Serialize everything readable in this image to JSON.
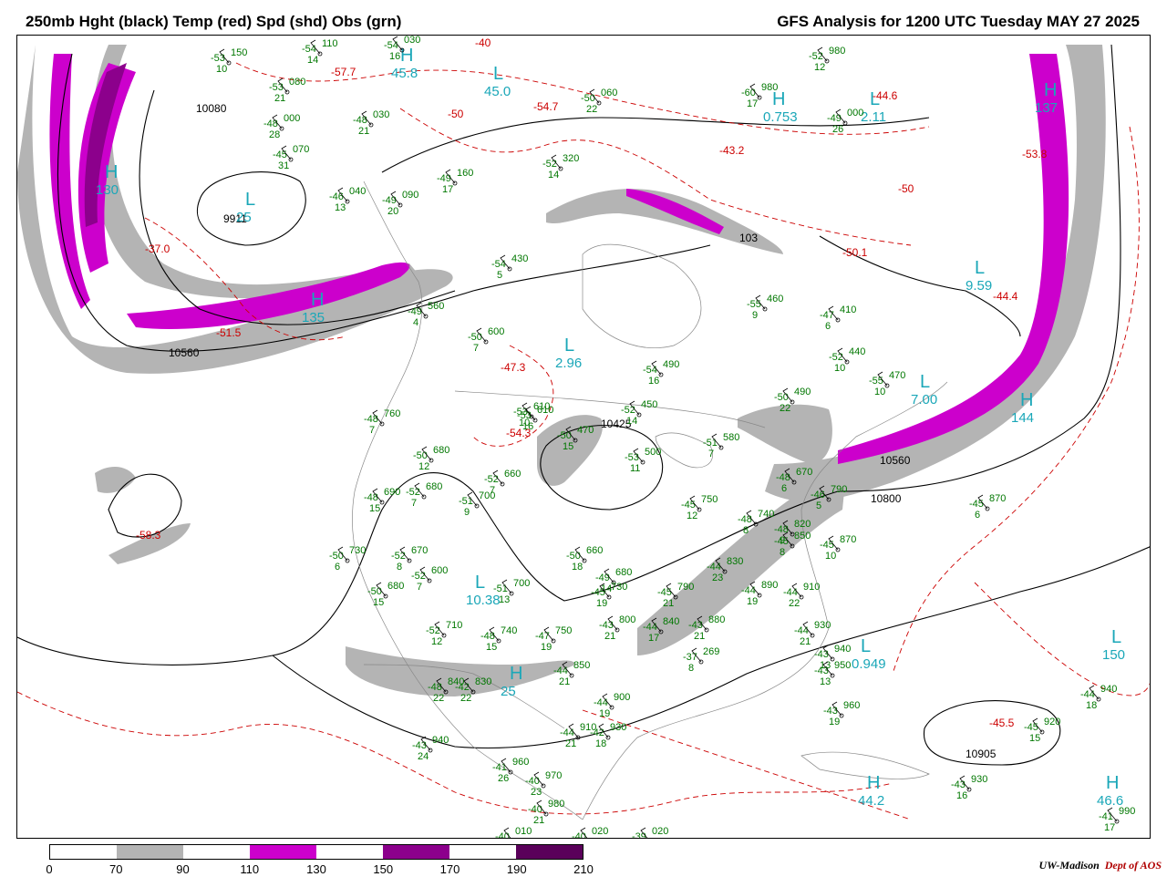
{
  "header": {
    "left_title": "250mb Hght (black) Temp (red) Spd (shd) Obs (grn)",
    "right_title": "GFS Analysis for 1200 UTC Tuesday  MAY 27 2025"
  },
  "legend": {
    "ticks": [
      "0",
      "70",
      "90",
      "110",
      "130",
      "150",
      "170",
      "190",
      "210"
    ],
    "colors": [
      "#ffffff",
      "#b4b4b4",
      "#ffffff",
      "#cc00cc",
      "#ffffff",
      "#8c008c",
      "#ffffff",
      "#5a005a"
    ]
  },
  "credit": {
    "org": "UW-Madison",
    "dept": "Dept of AOS"
  },
  "colors": {
    "height": "#000000",
    "temp": "#cc0000",
    "obs": "#007700",
    "center": "#1aa7b8",
    "jet_outer": "#b4b4b4",
    "jet_mid": "#cc00cc",
    "jet_core": "#8c008c"
  },
  "map": {
    "height_labels": [
      "10080",
      "9911",
      "10560",
      "10560",
      "10800",
      "10800",
      "10905",
      "10425",
      "103"
    ],
    "centers": [
      {
        "type": "L",
        "value": "25"
      },
      {
        "type": "L",
        "value": "45.0"
      },
      {
        "type": "H",
        "value": "45.8"
      },
      {
        "type": "L",
        "value": "2.11"
      },
      {
        "type": "H",
        "value": "0.753"
      },
      {
        "type": "L",
        "value": "2.96"
      },
      {
        "type": "L",
        "value": "7.00"
      },
      {
        "type": "L",
        "value": "9.59"
      },
      {
        "type": "L",
        "value": "10.38"
      },
      {
        "type": "H",
        "value": "25"
      },
      {
        "type": "L",
        "value": "0.949"
      },
      {
        "type": "L",
        "value": "150"
      },
      {
        "type": "H",
        "value": "44.2"
      },
      {
        "type": "H",
        "value": "46.6"
      },
      {
        "type": "H",
        "value": "135"
      },
      {
        "type": "H",
        "value": "130"
      },
      {
        "type": "H",
        "value": "137"
      },
      {
        "type": "H",
        "value": "144"
      }
    ],
    "temp_labels": [
      "-37.0",
      "-51.5",
      "-58.3",
      "-54.7",
      "-43.2",
      "-57.7",
      "-47.3",
      "-54.3",
      "-50.1",
      "-44.4",
      "-45.5",
      "-53.8",
      "-44.6",
      "-40",
      "-50",
      "-50"
    ],
    "obs": [
      {
        "t": "-53",
        "h": "150",
        "d": "10"
      },
      {
        "t": "-54",
        "h": "110",
        "d": "14"
      },
      {
        "t": "-54",
        "h": "030",
        "d": "16"
      },
      {
        "t": "-53",
        "h": "080",
        "d": "21"
      },
      {
        "t": "-48",
        "h": "000",
        "d": "28"
      },
      {
        "t": "-48",
        "h": "030",
        "d": "21"
      },
      {
        "t": "-45",
        "h": "070",
        "d": "31"
      },
      {
        "t": "-46",
        "h": "040",
        "d": "13"
      },
      {
        "t": "-49",
        "h": "090",
        "d": "20"
      },
      {
        "t": "-49",
        "h": "160",
        "d": "17"
      },
      {
        "t": "-52",
        "h": "320",
        "d": "14"
      },
      {
        "t": "-50",
        "h": "060",
        "d": "22"
      },
      {
        "t": "-60",
        "h": "980",
        "d": "17"
      },
      {
        "t": "-52",
        "h": "980",
        "d": "12"
      },
      {
        "t": "-49",
        "h": "000",
        "d": "26"
      },
      {
        "t": "-54",
        "h": "430",
        "d": "5"
      },
      {
        "t": "-49",
        "h": "560",
        "d": "4"
      },
      {
        "t": "-50",
        "h": "600",
        "d": "7"
      },
      {
        "t": "-53",
        "h": "610",
        "d": "10"
      },
      {
        "t": "-54",
        "h": "490",
        "d": "16"
      },
      {
        "t": "-52",
        "h": "450",
        "d": "14"
      },
      {
        "t": "-55",
        "h": "460",
        "d": "9"
      },
      {
        "t": "-47",
        "h": "410",
        "d": "6"
      },
      {
        "t": "-52",
        "h": "440",
        "d": "10"
      },
      {
        "t": "-55",
        "h": "470",
        "d": "10"
      },
      {
        "t": "-50",
        "h": "490",
        "d": "22"
      },
      {
        "t": "-48",
        "h": "760",
        "d": "7"
      },
      {
        "t": "-50",
        "h": "680",
        "d": "12"
      },
      {
        "t": "-53",
        "h": "610",
        "d": "16"
      },
      {
        "t": "-50",
        "h": "470",
        "d": "15"
      },
      {
        "t": "-53",
        "h": "500",
        "d": "11"
      },
      {
        "t": "-51",
        "h": "580",
        "d": "7"
      },
      {
        "t": "-52",
        "h": "680",
        "d": "7"
      },
      {
        "t": "-52",
        "h": "660",
        "d": "7"
      },
      {
        "t": "-48",
        "h": "690",
        "d": "15"
      },
      {
        "t": "-51",
        "h": "700",
        "d": "9"
      },
      {
        "t": "-48",
        "h": "670",
        "d": "6"
      },
      {
        "t": "-48",
        "h": "740",
        "d": "8"
      },
      {
        "t": "-45",
        "h": "750",
        "d": "12"
      },
      {
        "t": "-50",
        "h": "730",
        "d": "6"
      },
      {
        "t": "-52",
        "h": "670",
        "d": "8"
      },
      {
        "t": "-52",
        "h": "600",
        "d": "7"
      },
      {
        "t": "-50",
        "h": "680",
        "d": "15"
      },
      {
        "t": "-51",
        "h": "700",
        "d": "13"
      },
      {
        "t": "-50",
        "h": "660",
        "d": "18"
      },
      {
        "t": "-49",
        "h": "680",
        "d": "14"
      },
      {
        "t": "-45",
        "h": "730",
        "d": "19"
      },
      {
        "t": "-45",
        "h": "790",
        "d": "21"
      },
      {
        "t": "-44",
        "h": "830",
        "d": "23"
      },
      {
        "t": "-44",
        "h": "890",
        "d": "19"
      },
      {
        "t": "-44",
        "h": "910",
        "d": "22"
      },
      {
        "t": "-52",
        "h": "710",
        "d": "12"
      },
      {
        "t": "-48",
        "h": "740",
        "d": "15"
      },
      {
        "t": "-47",
        "h": "750",
        "d": "19"
      },
      {
        "t": "-43",
        "h": "800",
        "d": "21"
      },
      {
        "t": "-44",
        "h": "840",
        "d": "17"
      },
      {
        "t": "-43",
        "h": "880",
        "d": "21"
      },
      {
        "t": "-44",
        "h": "930",
        "d": "21"
      },
      {
        "t": "-43",
        "h": "940",
        "d": "13"
      },
      {
        "t": "-43",
        "h": "950",
        "d": "13"
      },
      {
        "t": "-43",
        "h": "960",
        "d": "19"
      },
      {
        "t": "-44",
        "h": "940",
        "d": "18"
      },
      {
        "t": "-45",
        "h": "920",
        "d": "15"
      },
      {
        "t": "-43",
        "h": "930",
        "d": "16"
      },
      {
        "t": "-41",
        "h": "990",
        "d": "17"
      },
      {
        "t": "-44",
        "h": "850",
        "d": "21"
      },
      {
        "t": "-44",
        "h": "900",
        "d": "19"
      },
      {
        "t": "-44",
        "h": "910",
        "d": "21"
      },
      {
        "t": "-42",
        "h": "930",
        "d": "18"
      },
      {
        "t": "-43",
        "h": "940",
        "d": "24"
      },
      {
        "t": "-41",
        "h": "960",
        "d": "26"
      },
      {
        "t": "-40",
        "h": "970",
        "d": "23"
      },
      {
        "t": "-40",
        "h": "980",
        "d": "21"
      },
      {
        "t": "-40",
        "h": "010",
        "d": "21"
      },
      {
        "t": "-40",
        "h": "020",
        "d": "21"
      },
      {
        "t": "-39",
        "h": "020",
        "d": "21"
      },
      {
        "t": "-45",
        "h": "870",
        "d": "6"
      },
      {
        "t": "-46",
        "h": "790",
        "d": "5"
      },
      {
        "t": "-48",
        "h": "820",
        "d": "9"
      },
      {
        "t": "-45",
        "h": "850",
        "d": "8"
      },
      {
        "t": "-45",
        "h": "870",
        "d": "10"
      },
      {
        "t": "-48",
        "h": "840",
        "d": "22"
      },
      {
        "t": "-42",
        "h": "830",
        "d": "22"
      },
      {
        "t": "-37",
        "h": "269",
        "d": "8"
      }
    ]
  }
}
